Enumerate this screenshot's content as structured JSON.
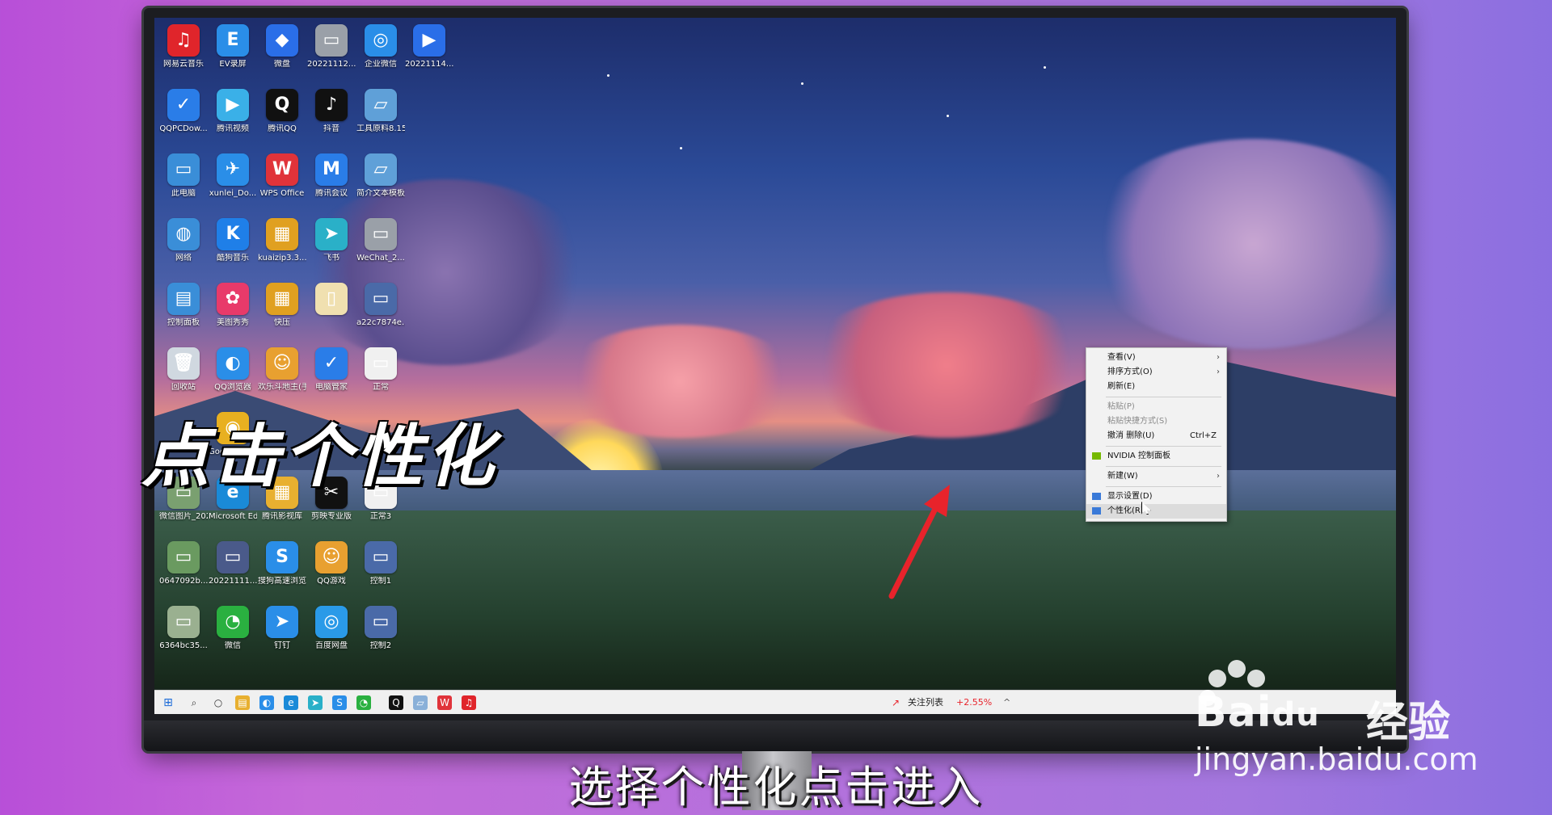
{
  "desktop_icons": [
    {
      "label": "网易云音乐",
      "color": "#e0252b",
      "glyph": "♫"
    },
    {
      "label": "EV录屏",
      "color": "#2a8ee8",
      "glyph": "E"
    },
    {
      "label": "微盘",
      "color": "#2a6ee8",
      "glyph": "◆"
    },
    {
      "label": "20221112...",
      "color": "#9aa0a8",
      "glyph": "▭"
    },
    {
      "label": "企业微信",
      "color": "#2a8ee8",
      "glyph": "◎"
    },
    {
      "label": "20221114...",
      "color": "#2a6ee8",
      "glyph": "▶"
    },
    {
      "label": "QQPCDow...",
      "color": "#2a7de8",
      "glyph": "✓"
    },
    {
      "label": "腾讯视频",
      "color": "#3ab0e8",
      "glyph": "▶"
    },
    {
      "label": "腾讯QQ",
      "color": "#111111",
      "glyph": "Q"
    },
    {
      "label": "抖音",
      "color": "#111111",
      "glyph": "♪"
    },
    {
      "label": "工具原料8.15",
      "color": "#5fa0d8",
      "glyph": "▱"
    },
    {
      "label": "此电脑",
      "color": "#3a8ed8",
      "glyph": "▭"
    },
    {
      "label": "xunlei_Do...",
      "color": "#2a8ee8",
      "glyph": "✈"
    },
    {
      "label": "WPS Office",
      "color": "#e0333a",
      "glyph": "W"
    },
    {
      "label": "腾讯会议",
      "color": "#2a7de8",
      "glyph": "M"
    },
    {
      "label": "简介文本模板",
      "color": "#5fa0d8",
      "glyph": "▱"
    },
    {
      "label": "网络",
      "color": "#3a8ed8",
      "glyph": "◍"
    },
    {
      "label": "酷狗音乐",
      "color": "#1f7fe8",
      "glyph": "K"
    },
    {
      "label": "kuaizip3.3....",
      "color": "#e0a020",
      "glyph": "▦"
    },
    {
      "label": "飞书",
      "color": "#2ab0c8",
      "glyph": "➤"
    },
    {
      "label": "WeChat_2...",
      "color": "#9aa0a8",
      "glyph": "▭"
    },
    {
      "label": "控制面板",
      "color": "#3a8ed8",
      "glyph": "▤"
    },
    {
      "label": "美图秀秀",
      "color": "#e83a6a",
      "glyph": "✿"
    },
    {
      "label": "快压",
      "color": "#e0a020",
      "glyph": "▦"
    },
    {
      "label": "",
      "color": "#f0e0b0",
      "glyph": "▯"
    },
    {
      "label": "a22c7874e...",
      "color": "#4a6aa8",
      "glyph": "▭"
    },
    {
      "label": "回收站",
      "color": "#d0d8e0",
      "glyph": "🗑"
    },
    {
      "label": "QQ浏览器",
      "color": "#2a8ee8",
      "glyph": "◐"
    },
    {
      "label": "欢乐斗地主(手游电脑版)",
      "color": "#e8a030",
      "glyph": "☺"
    },
    {
      "label": "电脑管家",
      "color": "#2a7de8",
      "glyph": "✓"
    },
    {
      "label": "正常",
      "color": "#f0f0f0",
      "glyph": "▭"
    },
    {
      "label": "Google Chrome",
      "color": "#e8b020",
      "glyph": "◉"
    },
    {
      "label": "微信图片_2022050...",
      "color": "#7aa070",
      "glyph": "▭"
    },
    {
      "label": "Microsoft Edge",
      "color": "#1a8ad8",
      "glyph": "e"
    },
    {
      "label": "腾讯影视库",
      "color": "#e8b030",
      "glyph": "▦"
    },
    {
      "label": "剪映专业版",
      "color": "#111111",
      "glyph": "✂"
    },
    {
      "label": "正常3",
      "color": "#f0f0f0",
      "glyph": "▭"
    },
    {
      "label": "0647092b...",
      "color": "#6a9a60",
      "glyph": "▭"
    },
    {
      "label": "20221111...",
      "color": "#4a5a8a",
      "glyph": "▭"
    },
    {
      "label": "搜狗高速浏览器",
      "color": "#2a8ee8",
      "glyph": "S"
    },
    {
      "label": "QQ游戏",
      "color": "#e8a030",
      "glyph": "☺"
    },
    {
      "label": "控制1",
      "color": "#4a6aa8",
      "glyph": "▭"
    },
    {
      "label": "6364bc35...",
      "color": "#9ab090",
      "glyph": "▭"
    },
    {
      "label": "微信",
      "color": "#2ab040",
      "glyph": "◔"
    },
    {
      "label": "钉钉",
      "color": "#2a8ee8",
      "glyph": "➤"
    },
    {
      "label": "百度网盘",
      "color": "#2a9ae8",
      "glyph": "◎"
    },
    {
      "label": "控制2",
      "color": "#4a6aa8",
      "glyph": "▭"
    }
  ],
  "overlay_caption": "点击个性化",
  "subtitle": "选择个性化点击进入",
  "context_menu": {
    "items": [
      {
        "label": "查看(V)",
        "submenu": true
      },
      {
        "label": "排序方式(O)",
        "submenu": true
      },
      {
        "label": "刷新(E)"
      },
      {
        "sep": true
      },
      {
        "label": "粘贴(P)",
        "disabled": true
      },
      {
        "label": "粘贴快捷方式(S)",
        "disabled": true
      },
      {
        "label": "撤消 删除(U)",
        "shortcut": "Ctrl+Z"
      },
      {
        "sep": true
      },
      {
        "label": "NVIDIA 控制面板",
        "icon": "nvidia"
      },
      {
        "sep": true
      },
      {
        "label": "新建(W)",
        "submenu": true
      },
      {
        "sep": true
      },
      {
        "label": "显示设置(D)",
        "icon": "display"
      },
      {
        "label": "个性化(R)",
        "icon": "personalize",
        "hover": true
      }
    ]
  },
  "taskbar": {
    "stock_label": "关注列表",
    "stock_change": "+2.55%",
    "icons": [
      "windows-start",
      "search",
      "cortana",
      "file-explorer",
      "qq-browser",
      "edge",
      "feishu",
      "sogou",
      "wechat",
      "qq",
      "notepad",
      "wps",
      "netease-music"
    ]
  },
  "watermark": {
    "brand": "Bai",
    "brand_suffix": "经验",
    "url": "jingyan.baidu.com"
  },
  "colors": {
    "accent_red": "#e8232b",
    "stock_red": "#e8232b"
  }
}
